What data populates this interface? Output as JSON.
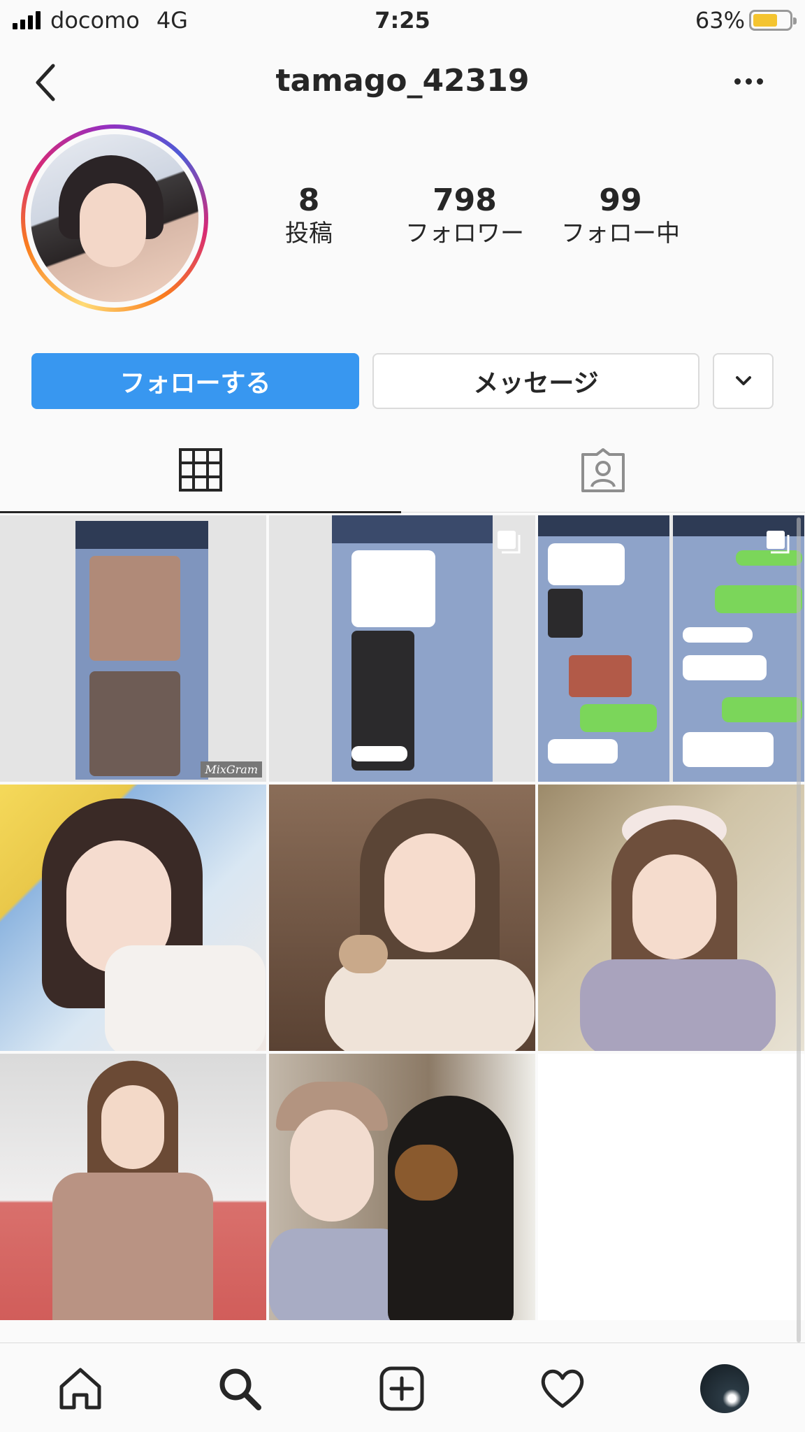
{
  "status_bar": {
    "carrier": "docomo",
    "network": "4G",
    "time": "7:25",
    "battery": "63%",
    "battery_level": 0.63
  },
  "header": {
    "username": "tamago_42319",
    "back_icon": "chevron-left-icon",
    "more_icon": "more-horizontal-icon"
  },
  "profile": {
    "stats": [
      {
        "value": "8",
        "label": "投稿"
      },
      {
        "value": "798",
        "label": "フォロワー"
      },
      {
        "value": "99",
        "label": "フォロー中"
      }
    ]
  },
  "actions": {
    "follow_label": "フォローする",
    "message_label": "メッセージ",
    "dropdown_icon": "chevron-down-icon"
  },
  "tabs": [
    {
      "icon": "grid-icon",
      "active": true
    },
    {
      "icon": "tagged-icon",
      "active": false
    }
  ],
  "posts": [
    {
      "type": "chat-screenshot",
      "caption": "MixGram",
      "multiple": false
    },
    {
      "type": "chat-screenshot",
      "multiple": true
    },
    {
      "type": "chat-screenshot",
      "multiple": true
    },
    {
      "type": "photo",
      "multiple": false
    },
    {
      "type": "photo",
      "multiple": false
    },
    {
      "type": "photo",
      "multiple": false
    },
    {
      "type": "photo",
      "multiple": false
    },
    {
      "type": "photo",
      "multiple": false
    }
  ],
  "tab_bar": [
    {
      "icon": "home-icon"
    },
    {
      "icon": "search-icon"
    },
    {
      "icon": "add-post-icon"
    },
    {
      "icon": "heart-icon"
    },
    {
      "icon": "profile-avatar"
    }
  ],
  "colors": {
    "follow_button": "#3897f0",
    "text": "#262626",
    "border": "#dbdbdb"
  }
}
